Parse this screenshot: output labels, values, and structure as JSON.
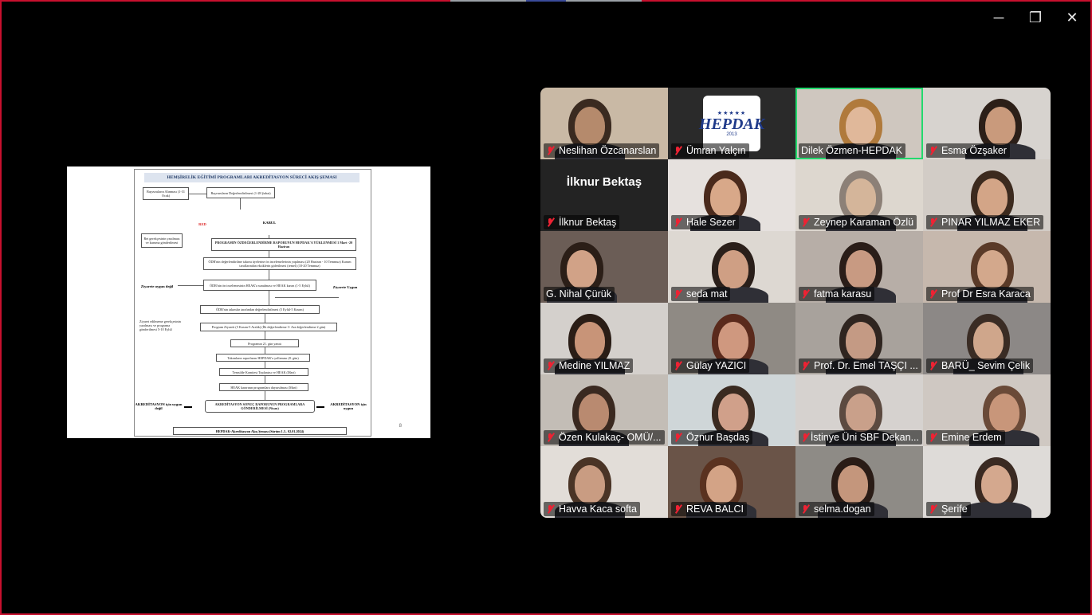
{
  "window": {
    "controls": {
      "minimize": "─",
      "restore": "❐",
      "close": "✕"
    }
  },
  "slide": {
    "title": "HEMŞİRELİK EĞİTİMİ PROGRAMLARI AKREDİTASYON SÜRECİ AKIŞ ŞEMASI",
    "footer": "HEPDAK-Akreditasyon Akış Şeması (Sürüm 1.3– 02.01.2024)",
    "page_number": "8",
    "nodes": {
      "n1": "Başvuruların Alınması (1-31 Ocak)",
      "n2": "Başvuruların Değerlendirilmesi (1-28 Şubat)",
      "red": "RED",
      "kabul": "KABUL",
      "ret": "Ret gerekçesinin yazılması ve kuruma gönderilmesi",
      "oz": "PROGRAMIN ÖZDEĞERLENDİRME RAPORUNUN HEPDAK'A YÜKLENMESİ 1 Mart -20 Haziran",
      "odr1": "ÖDR'nin değerlendirilme takımı üyelerine ön incelemelerinin yapılması (20 Haziran - 10 Temmuz) Kurum taraflarından eksiklerin giderilmesi (temel) (10-20 Temmuz)",
      "odr2": "ÖDR'nin ön incelemesinin HEAK'a sunulması ve HEAK kararı (1-5 Eylül)",
      "zd": "Ziyarete uygun değil",
      "zu": "Ziyarete Uygun",
      "zdtext": "Ziyaret edilmeme gerekçesinin yazılması ve programa gönderilmesi 5-10 Eylül",
      "odr3": "ÖDR'nin takımlar tarafından değerlendirilmesi (5 Eylül-5 Kasım)",
      "visit": "Program Ziyareti (5 Kasım-5 Aralık) (İlk değerlendirme 3- Ara değerlendirme 2 gün)",
      "resp": "Programın 21. gün yanıtı",
      "team": "Takımların raporlarını HEPDAK'a yollaması (8. gün)",
      "tc": "Temsilde Komitesi Toplantısı ve HEAK (Mart)",
      "heak": "HEAK kararının programlara duyurulması (Mart)",
      "result": "AKREDİTASYON SONUÇ RAPORUNUN PROGRAMLARA GÖNDERİLMESİ (Nisan)",
      "nope": "AKREDİTASYON için uygun değil",
      "yes": "AKREDİTASYON için uygun"
    }
  },
  "participants": [
    {
      "name": "Neslihan Özcanarslan",
      "muted": true,
      "kind": "video",
      "bg": "#c9b9a5",
      "skin": "#b58a6c",
      "hair": "#3a2a20"
    },
    {
      "name": "Ümran Yalçın",
      "muted": true,
      "kind": "logo",
      "bg": "#2a2a2a",
      "logo_stars": "★★★★★",
      "logo_word": "HEPDAK",
      "logo_year": "2013"
    },
    {
      "name": "Dilek Özmen-HEPDAK",
      "muted": false,
      "kind": "video",
      "active": true,
      "bg": "#cfc7bf",
      "skin": "#e0b89a",
      "hair": "#b07a3c"
    },
    {
      "name": "Esma Özşaker",
      "muted": true,
      "kind": "video",
      "bg": "#d7d3cf",
      "skin": "#c99a7c",
      "hair": "#2c1f18"
    },
    {
      "name": "İlknur Bektaş",
      "muted": true,
      "kind": "avatar",
      "bg": "#232323",
      "avatar_name": "İlknur Bektaş"
    },
    {
      "name": "Hale Sezer",
      "muted": true,
      "kind": "video",
      "bg": "#e6e1de",
      "skin": "#d8a889",
      "hair": "#4a2a1c"
    },
    {
      "name": "Zeynep Karaman Özlü",
      "muted": true,
      "kind": "video",
      "bg": "#ddd7cf",
      "skin": "#d4b59a",
      "hair": "#8c8077"
    },
    {
      "name": "PINAR YILMAZ EKER",
      "muted": true,
      "kind": "video",
      "bg": "#d2ccc6",
      "skin": "#d3a587",
      "hair": "#3c2a1e"
    },
    {
      "name": "G. Nihal Çürük",
      "muted": false,
      "kind": "video",
      "bg": "#6b5d56",
      "skin": "#d1a287",
      "hair": "#2b1e17"
    },
    {
      "name": "seda mat",
      "muted": true,
      "kind": "video",
      "bg": "#ddd8d2",
      "skin": "#cf9f84",
      "hair": "#2a1f1a"
    },
    {
      "name": "fatma karasu",
      "muted": true,
      "kind": "video",
      "bg": "#b7aea7",
      "skin": "#c89a82",
      "hair": "#2a1d18"
    },
    {
      "name": "Prof Dr Esra Karaca",
      "muted": true,
      "kind": "video",
      "bg": "#c6b8ad",
      "skin": "#d3a88c",
      "hair": "#5a3a28"
    },
    {
      "name": "Medine YILMAZ",
      "muted": true,
      "kind": "video",
      "bg": "#d4d0cc",
      "skin": "#c89478",
      "hair": "#2a1d16"
    },
    {
      "name": "Gülay YAZICI",
      "muted": true,
      "kind": "video",
      "bg": "#8f8a84",
      "skin": "#cf987f",
      "hair": "#5a2a1c"
    },
    {
      "name": "Prof. Dr. Emel TAŞÇI ...",
      "muted": true,
      "kind": "video",
      "bg": "#a8a29c",
      "skin": "#c49a84",
      "hair": "#2f2520"
    },
    {
      "name": "BARÜ_ Sevim Çelik",
      "muted": true,
      "kind": "video",
      "bg": "#8c8886",
      "skin": "#cfa68b",
      "hair": "#3a2c24"
    },
    {
      "name": "Özen Kulakaç- OMÜ/...",
      "muted": true,
      "kind": "video",
      "bg": "#c3bdb6",
      "skin": "#b98a70",
      "hair": "#3a2920"
    },
    {
      "name": "Öznur Başdaş",
      "muted": true,
      "kind": "video",
      "bg": "#cfd6d8",
      "skin": "#d0a08a",
      "hair": "#3a2a20"
    },
    {
      "name": "İstinye Üni SBF Dekan...",
      "muted": true,
      "kind": "video",
      "bg": "#d6d2cf",
      "skin": "#c9a08a",
      "hair": "#5c4a40"
    },
    {
      "name": "Emine Erdem",
      "muted": true,
      "kind": "video",
      "bg": "#cfc8c2",
      "skin": "#c8967a",
      "hair": "#6a4a38"
    },
    {
      "name": "Havva Kaca softa",
      "muted": true,
      "kind": "video",
      "bg": "#e2ddd8",
      "skin": "#c99c82",
      "hair": "#4a3426"
    },
    {
      "name": "REVA BALCI",
      "muted": true,
      "kind": "video",
      "bg": "#6a5448",
      "skin": "#d3a386",
      "hair": "#5a3220"
    },
    {
      "name": "selma.dogan",
      "muted": true,
      "kind": "video",
      "bg": "#8e8b86",
      "skin": "#c4967c",
      "hair": "#2a1c16"
    },
    {
      "name": "Şerife",
      "muted": true,
      "kind": "video",
      "bg": "#dedbd8",
      "skin": "#d4a88e",
      "hair": "#3a2a22"
    }
  ]
}
